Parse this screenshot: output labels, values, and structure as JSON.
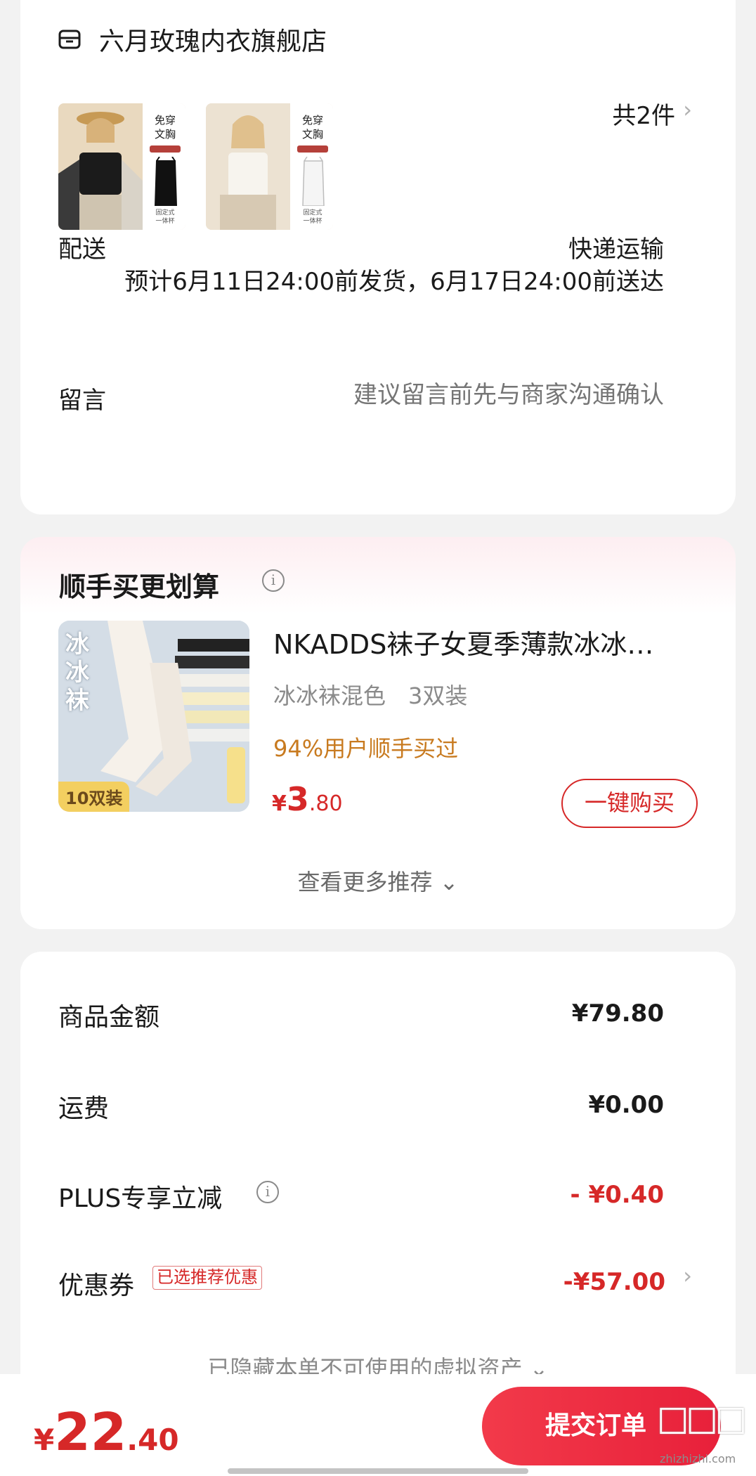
{
  "shop": {
    "name": "六月玫瑰内衣旗舰店",
    "icon": "shop-icon",
    "items": [
      {
        "tag_text": "免穿\n文胸",
        "foot_text": "固定式\n一体杯",
        "color": "black"
      },
      {
        "tag_text": "免穿\n文胸",
        "foot_text": "固定式\n一体杯",
        "color": "white"
      }
    ],
    "count": "共2件"
  },
  "delivery": {
    "label": "配送",
    "method": "快递运输",
    "eta": "预计6月11日24:00前发货，6月17日24:00前送达"
  },
  "message": {
    "label": "留言",
    "placeholder": "建议留言前先与商家沟通确认"
  },
  "upsell": {
    "title": "顺手买更划算",
    "product": {
      "name": "NKADDS袜子女夏季薄款冰冰…",
      "spec": "冰冰袜混色　3双装",
      "social_proof": "94%用户顺手买过",
      "price_symbol": "¥",
      "price_int": "3",
      "price_dec": ".80",
      "image_text": "冰\n冰\n袜",
      "image_tag": "10双装"
    },
    "buy_label": "一键购买",
    "more_label": "查看更多推荐 ⌄"
  },
  "summary": {
    "rows": [
      {
        "label": "商品金额",
        "value": "¥79.80"
      },
      {
        "label": "运费",
        "value": "¥0.00"
      },
      {
        "label": "PLUS专享立减",
        "value": "- ¥0.40"
      },
      {
        "label": "优惠券",
        "value": "-¥57.00",
        "tag": "已选推荐优惠"
      }
    ],
    "hidden_assets": "已隐藏本单不可使用的虚拟资产 ⌄"
  },
  "footer": {
    "total_symbol": "¥",
    "total_int": "22",
    "total_dec": ".40",
    "submit_label": "提交订单"
  },
  "watermark": {
    "url": "zhizhizhi.com"
  },
  "colors": {
    "accent": "#d62828",
    "muted": "#8a8a8a",
    "social": "#c87a1f"
  }
}
